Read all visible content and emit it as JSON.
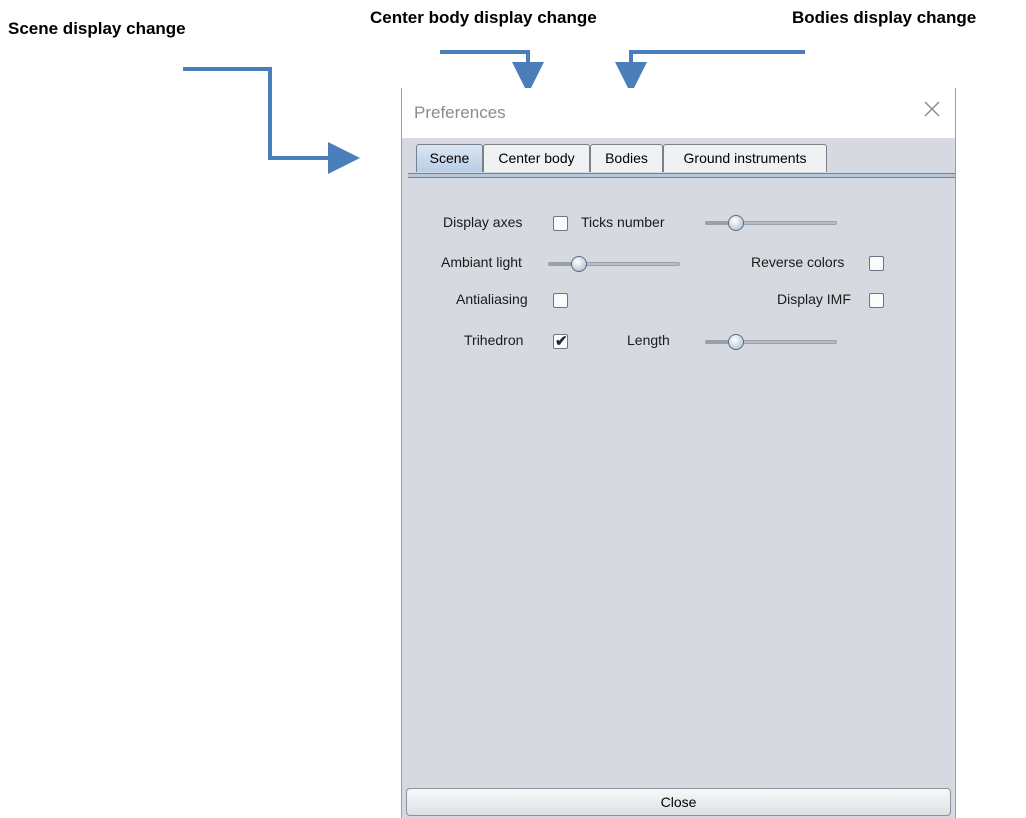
{
  "annotations": {
    "scene": "Scene display change",
    "center_body": "Center body display change",
    "bodies": "Bodies display change"
  },
  "window": {
    "title": "Preferences"
  },
  "tabs": [
    {
      "label": "Scene",
      "active": true
    },
    {
      "label": "Center body",
      "active": false
    },
    {
      "label": "Bodies",
      "active": false
    },
    {
      "label": "Ground instruments",
      "active": false
    }
  ],
  "scene": {
    "display_axes": {
      "label": "Display axes",
      "checked": false
    },
    "ticks_number": {
      "label": "Ticks number",
      "value": 0.2
    },
    "ambiant_light": {
      "label": "Ambiant light",
      "value": 0.2
    },
    "reverse_colors": {
      "label": "Reverse colors",
      "checked": false
    },
    "antialiasing": {
      "label": "Antialiasing",
      "checked": false
    },
    "display_imf": {
      "label": "Display IMF",
      "checked": false
    },
    "trihedron": {
      "label": "Trihedron",
      "checked": true
    },
    "length": {
      "label": "Length",
      "value": 0.2
    }
  },
  "footer": {
    "close_label": "Close"
  },
  "colors": {
    "arrow": "#4a7ebb",
    "panel": "#d6d9df"
  }
}
